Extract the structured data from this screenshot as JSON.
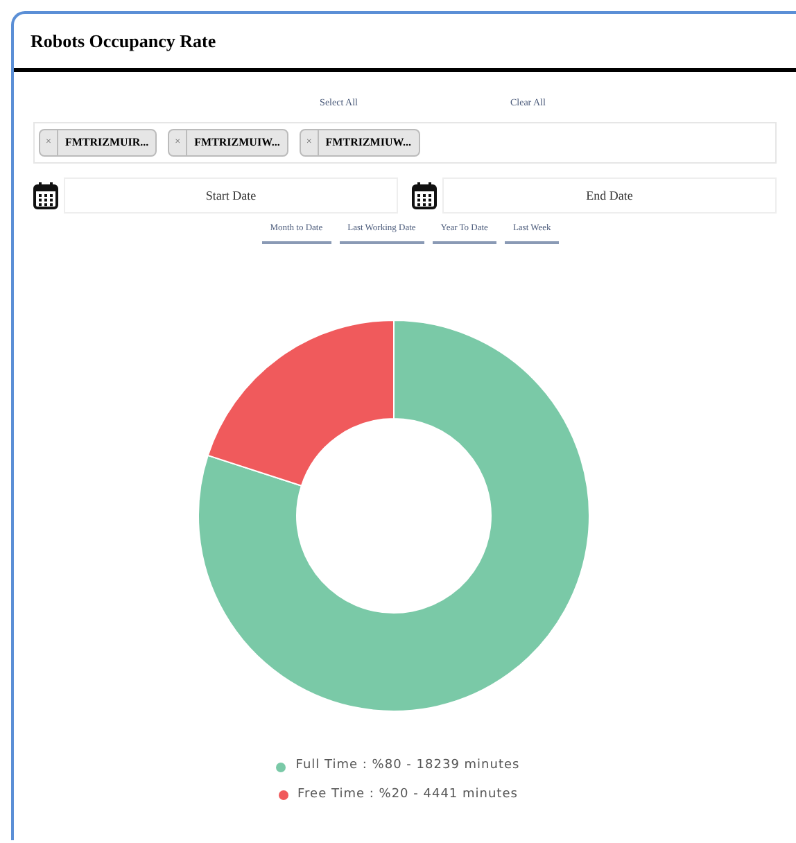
{
  "card": {
    "title": "Robots Occupancy Rate"
  },
  "selection_links": [
    "Select All",
    "Clear All"
  ],
  "chips": [
    {
      "remove": "×",
      "label": "FMTRIZMUIR..."
    },
    {
      "remove": "×",
      "label": "FMTRIZMUIW..."
    },
    {
      "remove": "×",
      "label": "FMTRIZMIUW..."
    }
  ],
  "date_fields": [
    {
      "placeholder": "Start Date"
    },
    {
      "placeholder": "End Date"
    }
  ],
  "quick_ranges": [
    "Month to Date",
    "Last Working Date",
    "Year To Date",
    "Last Week"
  ],
  "chart": {
    "chart_data": {
      "type": "donut",
      "values": [
        80,
        20
      ]
    },
    "legend": [
      {
        "label": "Full Time : %80 - 18239 minutes",
        "color": "#7ac9a7"
      },
      {
        "label": "Free Time : %20 - 4441 minutes",
        "color": "#f05a5c"
      }
    ]
  }
}
